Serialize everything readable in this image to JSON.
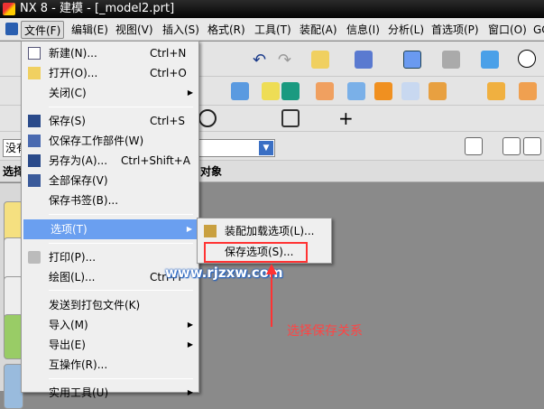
{
  "window": {
    "title": "NX 8 - 建模 - [_model2.prt]"
  },
  "menubar": [
    "文件(F)",
    "编辑(E)",
    "视图(V)",
    "插入(S)",
    "格式(R)",
    "工具(T)",
    "装配(A)",
    "信息(I)",
    "分析(L)",
    "首选项(P)",
    "窗口(O)",
    "GC"
  ],
  "filter": {
    "value": "没有"
  },
  "selbar": {
    "left": "选择",
    "right": "对象"
  },
  "file_menu": [
    {
      "label": "新建(N)...",
      "shortcut": "Ctrl+N"
    },
    {
      "label": "打开(O)...",
      "shortcut": "Ctrl+O"
    },
    {
      "label": "关闭(C)"
    },
    {
      "label": "保存(S)",
      "shortcut": "Ctrl+S"
    },
    {
      "label": "仅保存工作部件(W)"
    },
    {
      "label": "另存为(A)...",
      "shortcut": "Ctrl+Shift+A"
    },
    {
      "label": "全部保存(V)"
    },
    {
      "label": "保存书签(B)..."
    },
    {
      "label": "选项(T)"
    },
    {
      "label": "打印(P)..."
    },
    {
      "label": "绘图(L)...",
      "shortcut": "Ctrl+P"
    },
    {
      "label": "发送到打包文件(K)"
    },
    {
      "label": "导入(M)"
    },
    {
      "label": "导出(E)"
    },
    {
      "label": "互操作(R)..."
    },
    {
      "label": "实用工具(U)"
    }
  ],
  "options_submenu": [
    "装配加载选项(L)...",
    "保存选项(S)..."
  ],
  "annotation": {
    "watermark": "www.rjzxw.com",
    "note": "选择保存关系",
    "color": "#ff3333"
  }
}
